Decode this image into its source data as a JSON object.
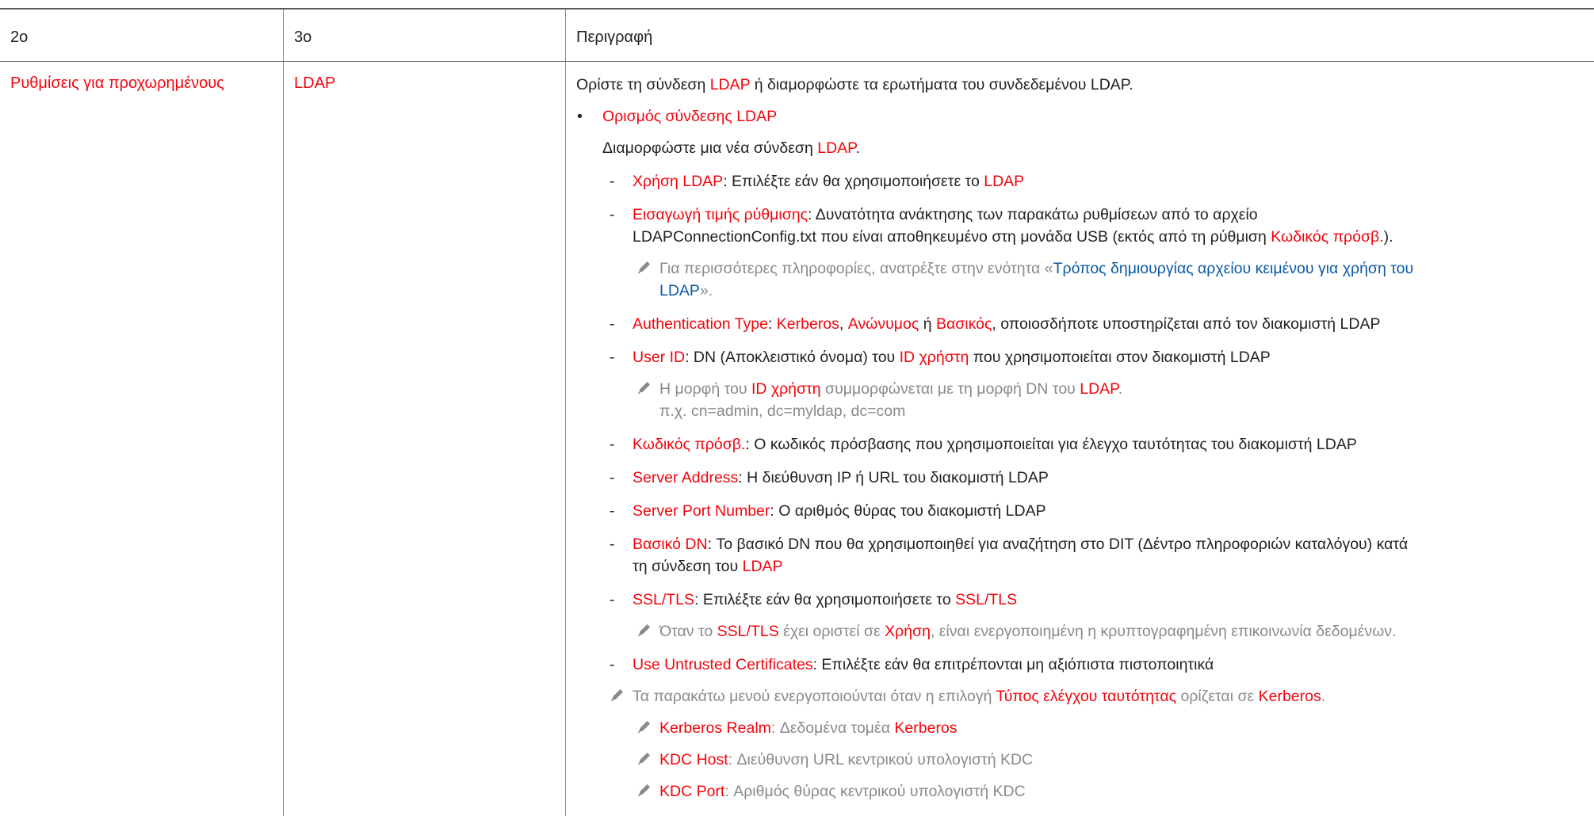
{
  "table": {
    "header": {
      "col1": "2ο",
      "col2": "3ο",
      "col3": "Περιγραφή"
    },
    "row": {
      "col1": "Ρυθμίσεις για προχωρημένους",
      "col2": "LDAP"
    }
  },
  "intro": {
    "a": "Ορίστε τη σύνδεση ",
    "b": "LDAP",
    "c": " ή διαμορφώστε τα ερωτήματα του συνδεδεμένου LDAP."
  },
  "bullet": {
    "mark": "•",
    "title": "Ορισμός σύνδεσης LDAP",
    "desc_a": "Διαμορφώστε μια νέα σύνδεση ",
    "desc_b": "LDAP",
    "desc_c": "."
  },
  "dash_mark": "-",
  "items": {
    "use": {
      "name": "Χρήση LDAP",
      "text": ": Επιλέξτε εάν θα χρησιμοποιήσετε το ",
      "tail": "LDAP"
    },
    "import": {
      "name": "Εισαγωγή τιμής ρύθμισης",
      "line1": ": Δυνατότητα ανάκτησης των παρακάτω ρυθμίσεων από το αρχείο",
      "line2a": "LDAPConnectionConfig.txt που είναι αποθηκευμένο στη μονάδα USB (εκτός από τη ρύθμιση ",
      "line2b": "Κωδικός πρόσβ.",
      "line2c": ").",
      "note_a": "Για περισσότερες πληροφορίες, ανατρέξτε στην ενότητα «",
      "note_link1": "Τρόπος δημιουργίας αρχείου κειμένου για χρήση του",
      "note_link2": "LDAP",
      "note_c": "»."
    },
    "auth": {
      "name": "Authentication Type",
      "t1": ": ",
      "o1": "Kerberos",
      "t2": ", ",
      "o2": "Ανώνυμος",
      "t3": " ή ",
      "o3": "Βασικός",
      "t4": ", οποιοσδήποτε υποστηρίζεται από τον διακομιστή LDAP"
    },
    "user": {
      "name": "User ID",
      "t1": ": DN (Αποκλειστικό όνομα) του ",
      "o1": "ID χρήστη",
      "t2": " που χρησιμοποιείται στον διακομιστή LDAP",
      "note_a": "Η μορφή του ",
      "note_b": "ID χρήστη",
      "note_c": " συμμορφώνεται με τη μορφή DN του ",
      "note_d": "LDAP",
      "note_e": ".",
      "note_line2": "π.χ. cn=admin, dc=myldap, dc=com"
    },
    "pass": {
      "name": "Κωδικός πρόσβ.",
      "text": ": Ο κωδικός πρόσβασης που χρησιμοποιείται για έλεγχο ταυτότητας του διακομιστή LDAP"
    },
    "server": {
      "name": "Server Address",
      "text": ": Η διεύθυνση IP ή URL του διακομιστή LDAP"
    },
    "port": {
      "name": "Server Port Number",
      "text": ": Ο αριθμός θύρας του διακομιστή LDAP"
    },
    "base": {
      "name": "Βασικό DN",
      "line1": ": Το βασικό DN που θα χρησιμοποιηθεί για αναζήτηση στο DIT (Δέντρο πληροφοριών καταλόγου) κατά",
      "line2a": "τη σύνδεση του ",
      "line2b": "LDAP"
    },
    "ssl": {
      "name": "SSL/TLS",
      "text": ": Επιλέξτε εάν θα χρησιμοποιήσετε το ",
      "tail": "SSL/TLS",
      "note_a": "Όταν το ",
      "note_b": "SSL/TLS",
      "note_c": " έχει οριστεί σε ",
      "note_d": "Χρήση",
      "note_e": ", είναι ενεργοποιημένη η κρυπτογραφημένη επικοινωνία δεδομένων."
    },
    "untrusted": {
      "name": "Use Untrusted Certificates",
      "text": ": Επιλέξτε εάν θα επιτρέπονται μη αξιόπιστα πιστοποιητικά"
    }
  },
  "kerb_note": {
    "a": "Τα παρακάτω μενού ενεργοποιούνται όταν η επιλογή ",
    "b": "Τύπος ελέγχου ταυτότητας",
    "c": " ορίζεται σε ",
    "d": "Kerberos",
    "e": ".",
    "realm_name": "Kerberos Realm",
    "realm_text": ": Δεδομένα τομέα ",
    "realm_tail": "Kerberos",
    "host_name": "KDC Host",
    "host_text": ": Διεύθυνση URL κεντρικού υπολογιστή KDC",
    "port_name": "KDC Port",
    "port_text": ": Αριθμός θύρας κεντρικού υπολογιστή KDC"
  },
  "colors": {
    "highlight": "#f2050d",
    "link": "#0a5aa5",
    "note": "#8a8a8a"
  },
  "icons": {
    "note": "pencil-icon"
  }
}
